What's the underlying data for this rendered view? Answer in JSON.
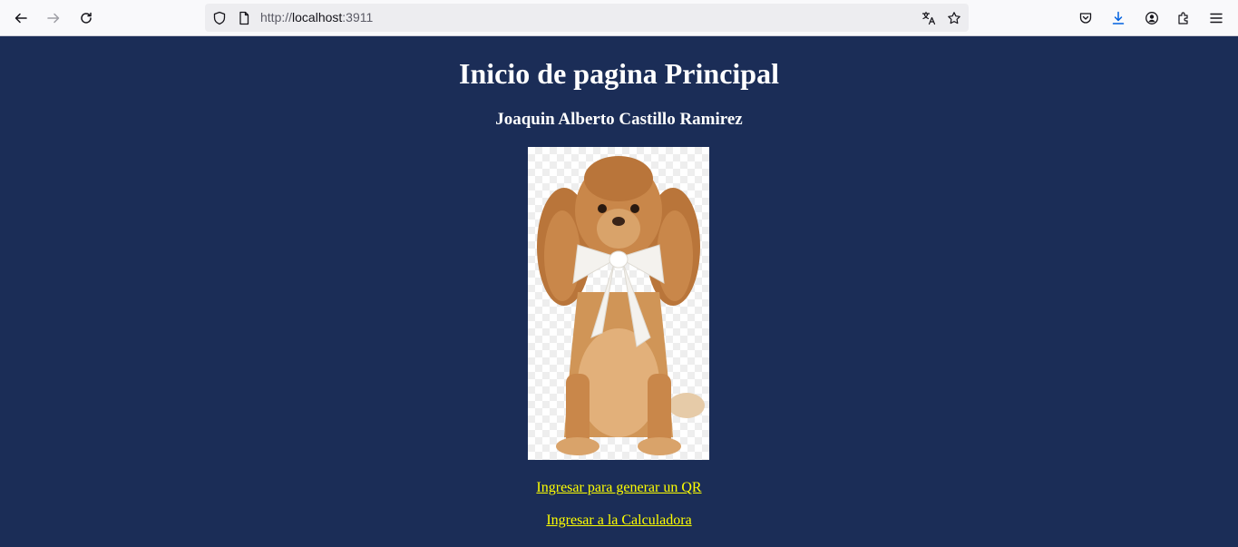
{
  "browser": {
    "url_scheme": "http://",
    "url_host": "localhost",
    "url_port": ":3911",
    "icons": [
      "back-icon",
      "forward-icon",
      "reload-icon",
      "shield-icon",
      "page-icon",
      "translate-icon",
      "bookmark-star-icon",
      "pocket-icon",
      "download-icon",
      "account-icon",
      "extensions-icon",
      "menu-icon"
    ]
  },
  "page": {
    "title": "Inicio de pagina Principal",
    "author": "Joaquin Alberto Castillo Ramirez",
    "links": [
      {
        "label": "Ingresar para generar un QR"
      },
      {
        "label": "Ingresar a la Calculadora"
      }
    ],
    "colors": {
      "background": "#1b2d57",
      "text": "#ffffff",
      "link": "#ffff00"
    }
  }
}
